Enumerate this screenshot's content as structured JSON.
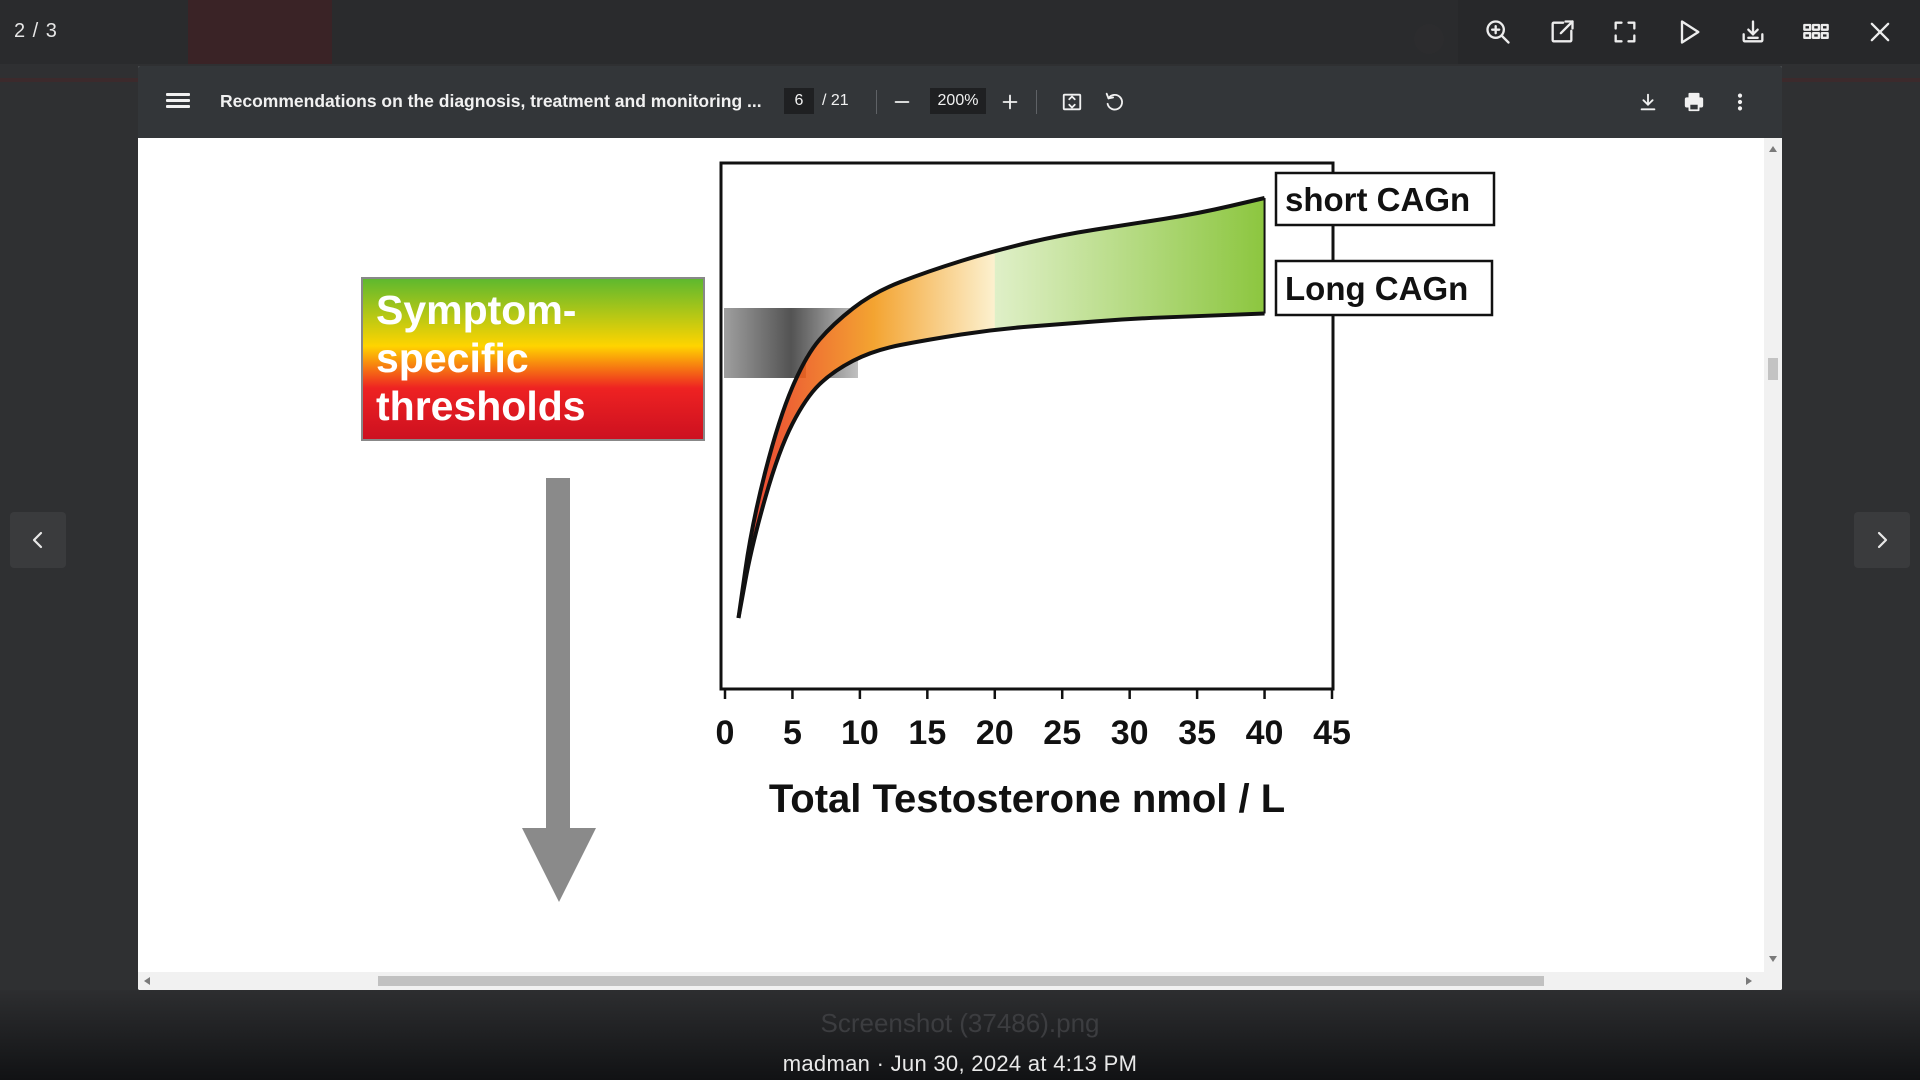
{
  "lightbox": {
    "counter": "2 / 3",
    "toolbar": {
      "zoom_icon": "zoom-in-icon",
      "open_icon": "open-external-icon",
      "fullscreen_icon": "fullscreen-icon",
      "play_icon": "play-icon",
      "download_icon": "download-icon",
      "thumbnails_icon": "grid-icon",
      "close_icon": "close-icon"
    },
    "caption_filename": "Screenshot (37486).png",
    "caption_meta": "madman · Jun 30, 2024 at 4:13 PM"
  },
  "pdf_viewer": {
    "title": "Recommendations on the diagnosis, treatment and monitoring ...",
    "current_page": "6",
    "total_pages": "/ 21",
    "zoom": "200%"
  },
  "figure": {
    "threshold_box": {
      "line1": "Symptom-",
      "line2": "specific",
      "line3": "thresholds",
      "gradient_colors": [
        "#5cb82f",
        "#ffd400",
        "#ee2222",
        "#cc1020"
      ]
    },
    "legend": {
      "short": "short CAGn",
      "long": "Long CAGn"
    },
    "colors": {
      "band_upper": "#8cc63f",
      "band_lower_warm": "#f39a1c",
      "band_red": "#e8331c",
      "arrow": "#8a8a8a"
    }
  },
  "chart_data": {
    "type": "line",
    "xlabel": "Total Testosterone nmol / L",
    "xlim": [
      0,
      45
    ],
    "xticks": [
      0,
      5,
      10,
      15,
      20,
      25,
      30,
      35,
      40,
      45
    ],
    "xtick_labels": [
      "0",
      "5",
      "10",
      "15",
      "20",
      "25",
      "30",
      "35",
      "40",
      "45"
    ],
    "series": [
      {
        "name": "short CAGn",
        "x": [
          1,
          2,
          4,
          6,
          8,
          11,
          15,
          20,
          25,
          30,
          35,
          40
        ],
        "y": [
          0.2,
          0.38,
          0.58,
          0.7,
          0.76,
          0.82,
          0.86,
          0.9,
          0.93,
          0.95,
          0.97,
          1.0
        ]
      },
      {
        "name": "Long CAGn",
        "x": [
          1,
          2,
          4,
          6,
          8,
          11,
          15,
          20,
          25,
          30,
          35,
          40
        ],
        "y": [
          0.2,
          0.34,
          0.52,
          0.62,
          0.67,
          0.71,
          0.73,
          0.75,
          0.76,
          0.77,
          0.775,
          0.78
        ]
      }
    ]
  }
}
